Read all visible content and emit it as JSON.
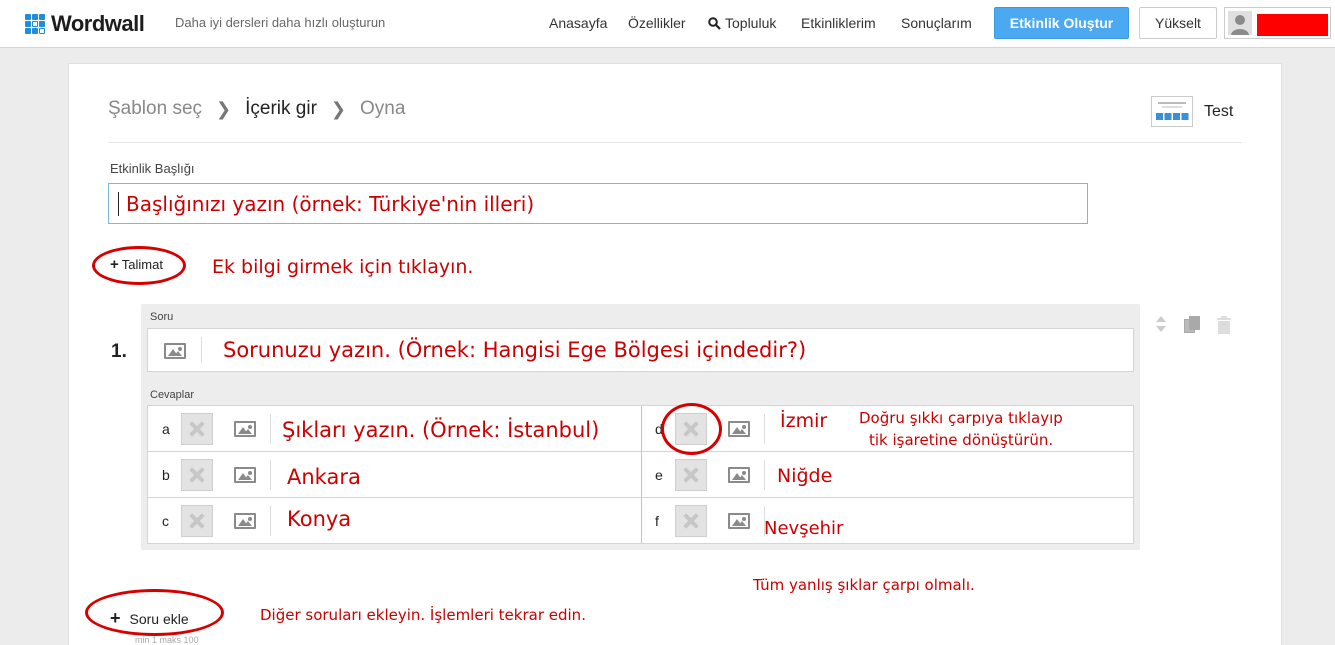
{
  "header": {
    "logo_text": "Wordwall",
    "tagline": "Daha iyi dersleri daha hızlı oluşturun",
    "nav": [
      "Anasayfa",
      "Özellikler",
      "Topluluk",
      "Etkinliklerim",
      "Sonuçlarım"
    ],
    "create_button": "Etkinlik Oluştur",
    "upgrade_button": "Yükselt"
  },
  "breadcrumb": {
    "steps": [
      "Şablon seç",
      "İçerik gir",
      "Oyna"
    ],
    "template_name": "Test"
  },
  "activity": {
    "title_label": "Etkinlik Başlığı",
    "title_value": "",
    "instruction_button": "Talimat"
  },
  "question": {
    "number": "1.",
    "label": "Soru",
    "answers_label": "Cevaplar",
    "answers": [
      {
        "letter": "a"
      },
      {
        "letter": "b"
      },
      {
        "letter": "c"
      },
      {
        "letter": "d"
      },
      {
        "letter": "e"
      },
      {
        "letter": "f"
      }
    ]
  },
  "footer": {
    "add_question": "Soru ekle",
    "min_max": "min 1   maks 100"
  },
  "annotations": {
    "title_hint": "Başlığınızı yazın (örnek: Türkiye'nin illeri)",
    "instruction_hint": "Ek bilgi girmek için tıklayın.",
    "question_hint": "Sorunuzu yazın. (Örnek: Hangisi Ege Bölgesi içindedir?)",
    "option_hint": "Şıkları yazın. (Örnek: İstanbul)",
    "answer_b": "Ankara",
    "answer_c": "Konya",
    "answer_d": "İzmir",
    "answer_e": "Niğde",
    "answer_f": "Nevşehir",
    "correct_hint_1": "Doğru şıkkı çarpıya tıklayıp",
    "correct_hint_2": "tik işaretine dönüştürün.",
    "wrong_hint": "Tüm yanlış şıklar çarpı olmalı.",
    "add_hint": "Diğer soruları ekleyin. İşlemleri tekrar edin."
  },
  "colors": {
    "accent": "#4aa9f0",
    "annotation": "#cc0000",
    "logo_blue": "#1d8ddc"
  }
}
